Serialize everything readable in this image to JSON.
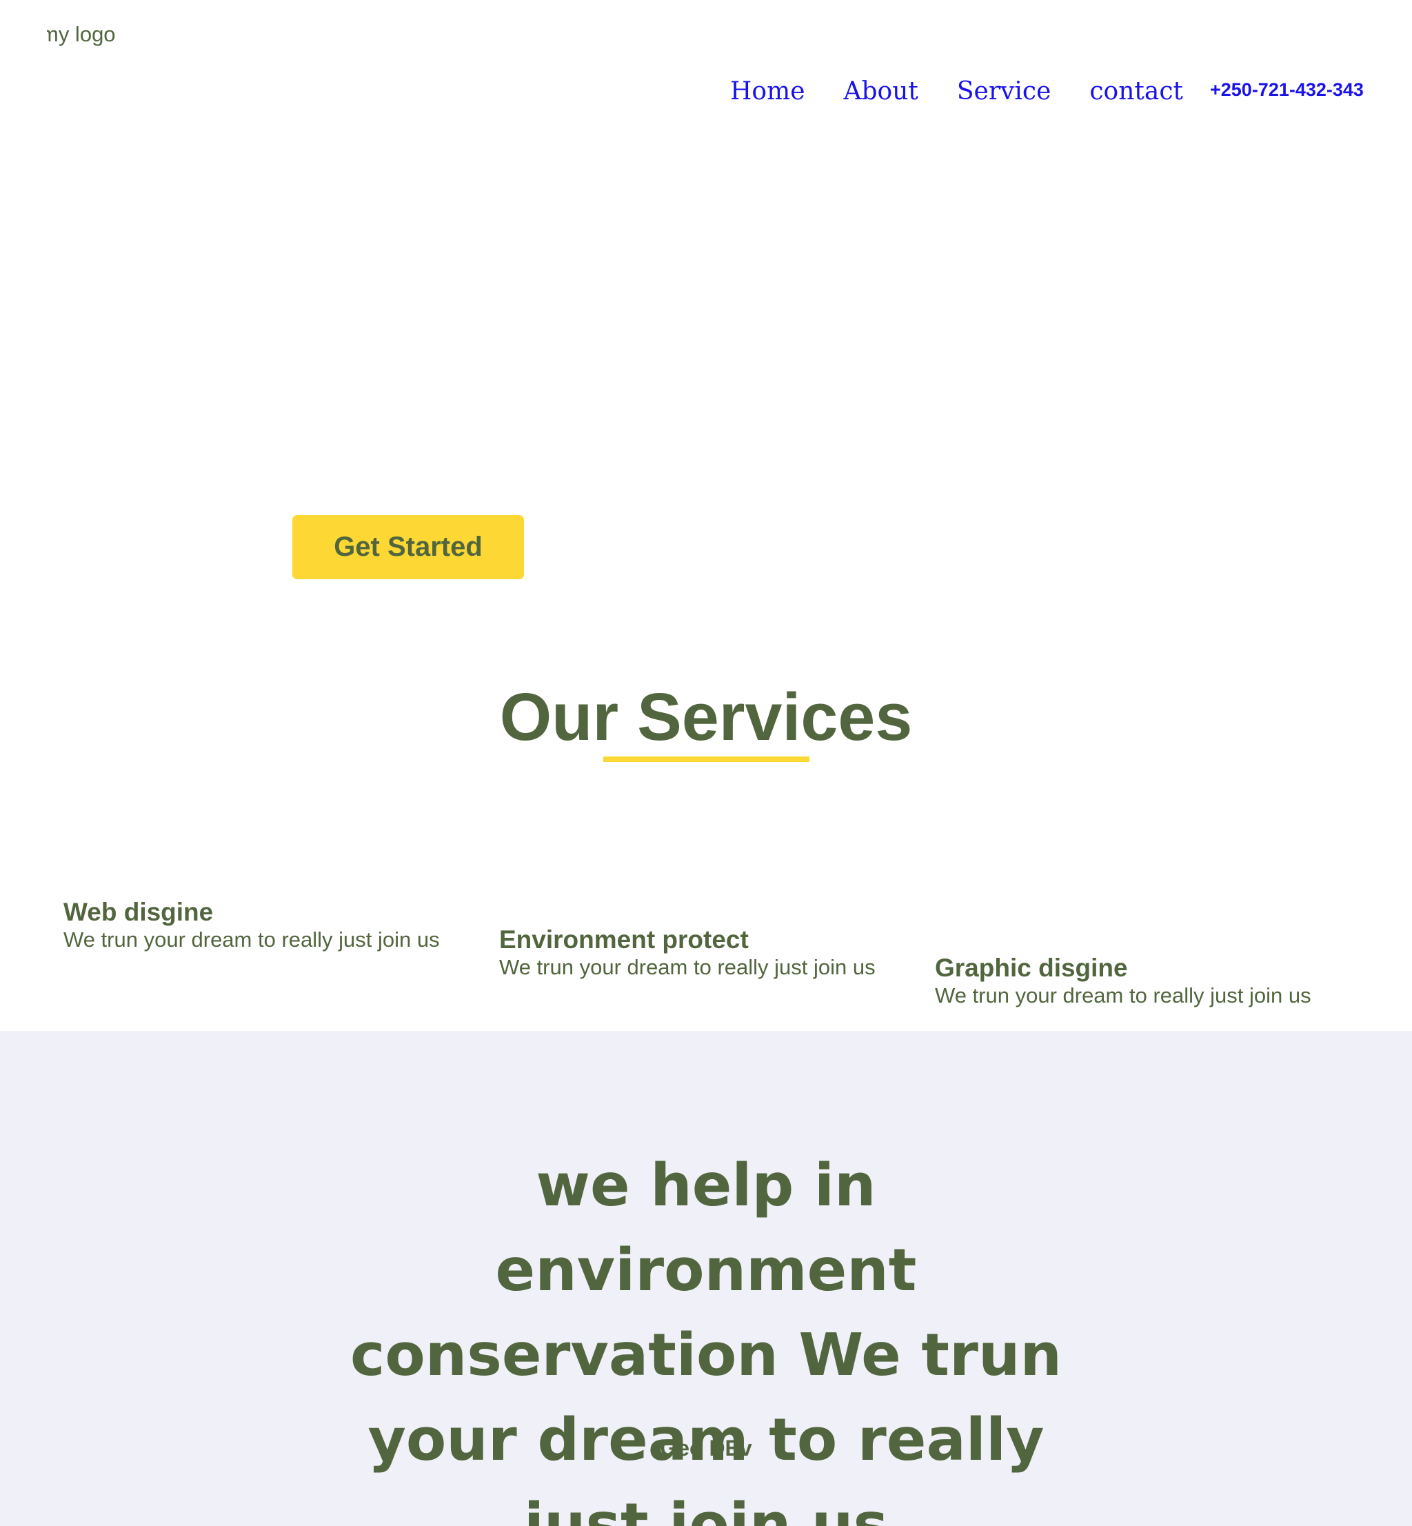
{
  "header": {
    "logo_text": "my logo",
    "nav": [
      {
        "label": "Home"
      },
      {
        "label": "About"
      },
      {
        "label": "Service"
      },
      {
        "label": "contact"
      }
    ],
    "phone": "+250-721-432-343"
  },
  "hero": {
    "cta_label": "Get Started"
  },
  "services": {
    "title": "Our Services",
    "items": [
      {
        "title": "Web disgine",
        "description": "We trun your dream to really just join us"
      },
      {
        "title": "Environment protect",
        "description": "We trun your dream to really just join us"
      },
      {
        "title": "Graphic disgine",
        "description": "We trun your dream to really just join us"
      }
    ]
  },
  "mission": {
    "text": "we help in environment conservation We trun your dream to really just join us",
    "signature": "Geo DEv"
  },
  "colors": {
    "accent_yellow": "#fdd835",
    "text_green": "#51663e",
    "nav_blue": "#1a12e8",
    "band_background": "#f0f1f8"
  }
}
